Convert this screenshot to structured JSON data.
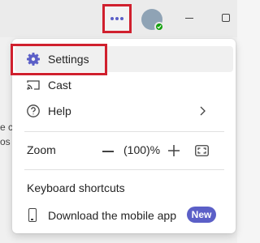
{
  "titlebar": {
    "more_icon": "more-horizontal-icon",
    "avatar_icon": "avatar",
    "presence": "available",
    "minimize_icon": "minimize-icon",
    "maximize_icon": "maximize-icon"
  },
  "background": {
    "fragment_1": "e c",
    "fragment_2": "os"
  },
  "menu": {
    "items": [
      {
        "label": "Settings",
        "icon": "gear-icon"
      },
      {
        "label": "Cast",
        "icon": "cast-icon"
      },
      {
        "label": "Help",
        "icon": "help-circle-icon"
      }
    ],
    "zoom": {
      "label": "Zoom",
      "value": "(100)%"
    },
    "keyboard_shortcuts": "Keyboard shortcuts",
    "download": {
      "label": "Download the mobile app",
      "badge": "New"
    }
  },
  "colors": {
    "accent": "#5b5fc7",
    "highlight": "#d0202e",
    "presence": "#13a10e"
  }
}
